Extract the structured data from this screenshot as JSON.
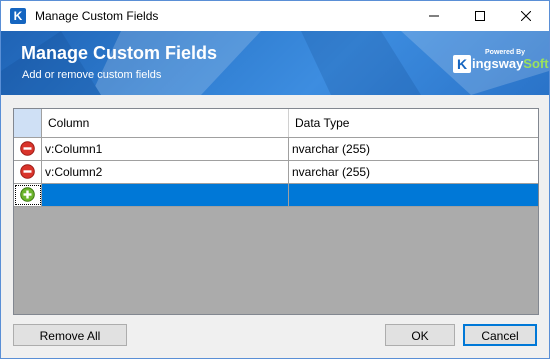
{
  "window": {
    "title": "Manage Custom Fields",
    "app_icon_letter": "K"
  },
  "banner": {
    "title": "Manage Custom Fields",
    "subtitle": "Add or remove custom fields",
    "logo": {
      "powered_by": "Powered By",
      "letter": "K",
      "word_main": "ingsway",
      "word_accent": "Soft"
    }
  },
  "grid": {
    "columns": [
      "Column",
      "Data Type"
    ],
    "rows": [
      {
        "action": "remove-icon",
        "column": "v:Column1",
        "data_type": "nvarchar (255)"
      },
      {
        "action": "remove-icon",
        "column": "v:Column2",
        "data_type": "nvarchar (255)"
      }
    ],
    "new_row": {
      "action": "add-icon",
      "column": "",
      "data_type": ""
    }
  },
  "buttons": {
    "remove_all": "Remove All",
    "ok": "OK",
    "cancel": "Cancel"
  },
  "colors": {
    "banner": "#2f7dd0",
    "selection": "#0078d7",
    "remove": "#d9342b",
    "add": "#6cb52d"
  }
}
